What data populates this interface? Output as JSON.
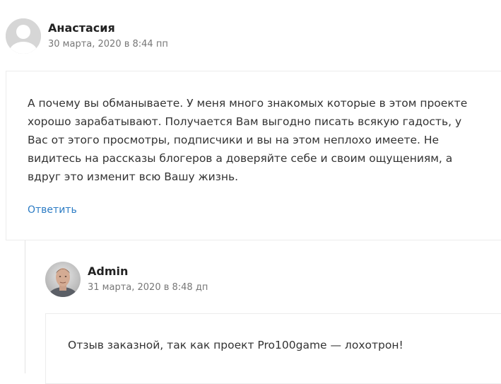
{
  "comments": [
    {
      "author": "Анастасия",
      "date": "30 марта, 2020 в 8:44 пп",
      "avatar": "default-avatar-icon",
      "text": "А почему вы обманываете. У меня много знакомых которые в этом проекте хорошо зарабатывают. Получается Вам выгодно писать всякую гадость, у Вас от этого просмотры, подписчики и вы на этом неплохо имеете. Не видитесь на рассказы блогеров а доверяйте себе и своим ощущениям, а вдруг это изменит всю Вашу жизнь.",
      "reply_label": "Ответить"
    },
    {
      "author": "Admin",
      "date": "31 марта, 2020 в 8:48 дп",
      "avatar": "user-photo-avatar",
      "text": "Отзыв заказной, так как проект Pro100game — лохотрон!"
    }
  ],
  "colors": {
    "link": "#2b7bc4",
    "border": "#ececec",
    "date": "#777777"
  }
}
